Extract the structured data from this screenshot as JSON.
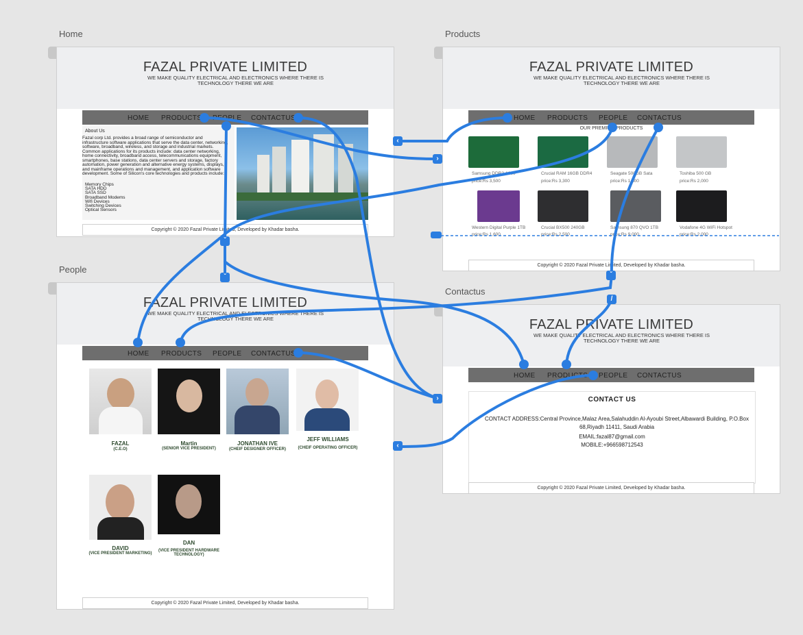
{
  "artboards": {
    "home": "Home",
    "products": "Products",
    "people": "People",
    "contactus": "Contactus"
  },
  "site": {
    "title": "FAZAL PRIVATE LIMITED",
    "tagline": "WE MAKE QUALITY ELECTRICAL AND ELECTRONICS WHERE THERE IS TECHNOLOGY THERE WE ARE",
    "nav": [
      "HOME",
      "PRODUCTS",
      "PEOPLE",
      "CONTACTUS"
    ],
    "footer": "Copyright © 2020 Fazal Private Limited, Developed by Khadar basha."
  },
  "home": {
    "about_heading": "About Us",
    "about_text": "Fazal corp Ltd. provides a broad range of semiconductor and infrastructure software applications that serve the data center, networking, software, broadband, wireless, and storage and industrial markets. Common applications for its products include: data center networking, home connectivity, broadband access, telecommunications equipment, smartphones, base stations, data center servers and storage, factory automation, power generation and alternative energy systems, displays, and mainframe operations and management, and application software development. Some of Silicon's core technologies and products include:",
    "list": [
      "Memory Chips",
      "SATA HDD",
      "SATA SSD",
      "Broadband Modems",
      "Wifi Devices",
      "Switching Devices",
      "Optical Sensors"
    ]
  },
  "products": {
    "heading": "OUR PREMIUM PRODUCTS",
    "items": [
      {
        "name": "Samsung DDR3-1600",
        "price": "price:Rs 3,500"
      },
      {
        "name": "Crucial RAM 16GB DDR4",
        "price": "price:Rs 3,300"
      },
      {
        "name": "Seagate 500GB Sata",
        "price": "price:Rs 1,600"
      },
      {
        "name": "Toshiba 500 GB",
        "price": "price:Rs 2,000"
      },
      {
        "name": "Western Digital Purple 1TB",
        "price": "price:Rs 1,600"
      },
      {
        "name": "Crucial BX500 240GB",
        "price": "price:Rs 2,500"
      },
      {
        "name": "Samsung 870 QVO 1TB",
        "price": "price:Rs 9,000"
      },
      {
        "name": "Vodafone 4G WiFi Hotspot",
        "price": "price:Rs 2,000"
      }
    ]
  },
  "people": {
    "members": [
      {
        "name": "FAZAL",
        "role": "(C.E.O)"
      },
      {
        "name": "Martin",
        "role": "(SENIOR VICE PRESIDENT)"
      },
      {
        "name": "JONATHAN IVE",
        "role": "(CHEIF DESIGNER OFFICER)"
      },
      {
        "name": "JEFF WILLIAMS",
        "role": "(CHEIF OPERATING OFFICER)"
      },
      {
        "name": "DAVID",
        "role": "(VICE PRESIDENT MARKETING)"
      },
      {
        "name": "DAN",
        "role": "(VICE PRESIDENT HARDWARE TECHNOLOGY)"
      }
    ]
  },
  "contact": {
    "heading": "CONTACT US",
    "address": "CONTACT ADDRESS:Central Province,Malaz Area,Salahuddin Al-Ayoubi Street,Albawardi Building, P.O.Box 68,Riyadh 11411, Saudi Arabia",
    "email": "EMAIL:fazal87@gmail.com",
    "mobile": "MOBILE:+966598712543"
  },
  "colors": {
    "canvas": "#e6e6e6",
    "wire": "#2b7de0",
    "nav_bar": "#6e6e6e",
    "header_band": "#eeeff1",
    "person_name": "#2e4a2e"
  },
  "icons": [
    "chevron-right-icon",
    "chevron-left-icon",
    "chevron-down-icon",
    "link-handle-icon"
  ]
}
